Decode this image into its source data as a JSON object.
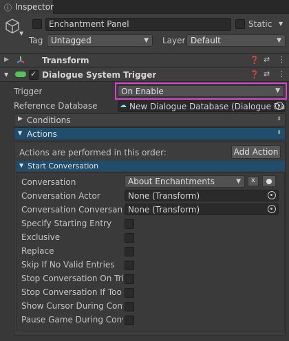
{
  "tab": {
    "title": "Inspector"
  },
  "object": {
    "name": "Enchantment Panel",
    "static_label": "Static",
    "tag_label": "Tag",
    "tag_value": "Untagged",
    "layer_label": "Layer",
    "layer_value": "Default"
  },
  "components": {
    "transform": {
      "title": "Transform"
    },
    "dialogue_trigger": {
      "title": "Dialogue System Trigger"
    }
  },
  "trigger": {
    "label": "Trigger",
    "value": "On Enable",
    "highlight_color": "#e040d0"
  },
  "database": {
    "label": "Reference Database",
    "value": "New Dialogue Database (Dialogue Da"
  },
  "foldouts": {
    "conditions": "Conditions",
    "actions": "Actions"
  },
  "actions": {
    "order_text": "Actions are performed in this order:",
    "add_action": "Add Action",
    "start_conversation": "Start Conversation"
  },
  "conversation": {
    "conversation_label": "Conversation",
    "conversation_value": "About Enchantments",
    "clear_label": "x",
    "actor_label": "Conversation Actor",
    "actor_value": "None (Transform)",
    "conversant_label": "Conversation Conversant",
    "conversant_value": "None (Transform)",
    "checkboxes": [
      "Specify Starting Entry",
      "Exclusive",
      "Replace",
      "Skip If No Valid Entries",
      "Stop Conversation On Trig",
      "Stop Conversation If Too F",
      "Show Cursor During Conve",
      "Pause Game During Conve"
    ]
  },
  "colors": {
    "panel_bg": "#383838",
    "header_bg": "#3e3e3e",
    "actions_header_bg": "#1f4d6b",
    "accent_blue": "#2f6a8f"
  }
}
